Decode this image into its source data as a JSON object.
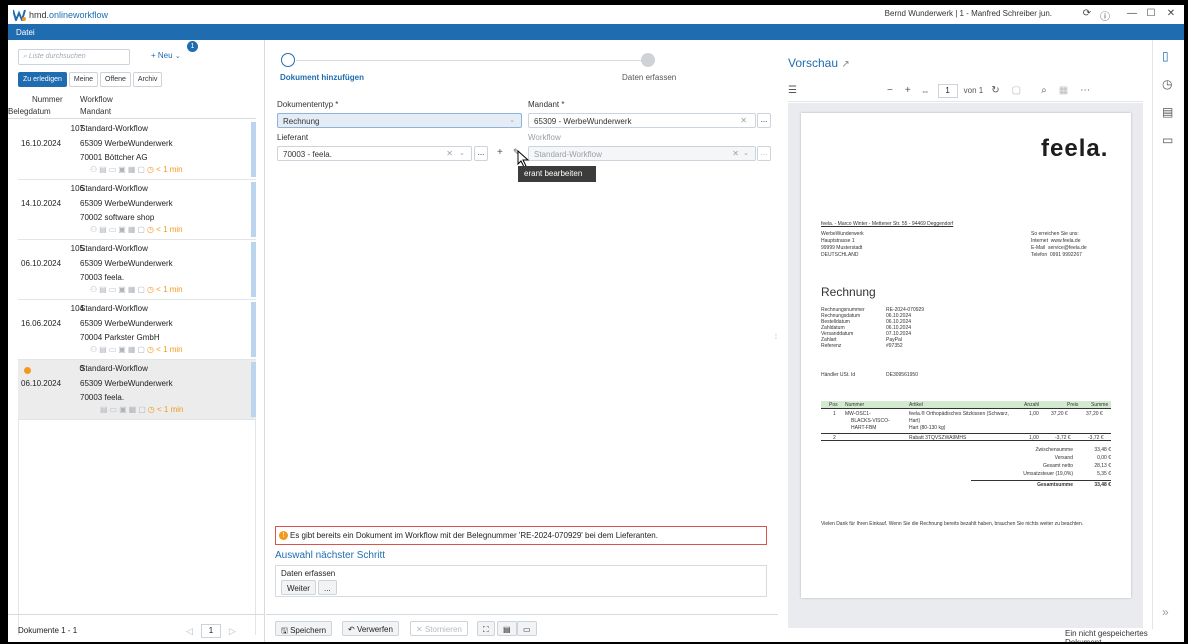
{
  "window": {
    "app_prefix": "hmd.",
    "app_name": "onlineworkflow",
    "user": "Bernd Wunderwerk | 1 - Manfred Schreiber jun."
  },
  "menu": {
    "datei": "Datei"
  },
  "left": {
    "search_placeholder": "Liste durchsuchen",
    "neu": "Neu",
    "badge": "1",
    "tabs": [
      "Zu erledigen",
      "Meine",
      "Offene",
      "Archiv"
    ],
    "col_nummer": "Nummer",
    "col_belegdatum": "Belegdatum",
    "col_workflow": "Workflow",
    "col_mandant": "Mandant",
    "rows": [
      {
        "num": "107",
        "date": "16.10.2024",
        "workflow": "Standard-Workflow",
        "mandant": "65309  WerbeWunderwerk",
        "partner": "70001  Böttcher AG",
        "time": "< 1 min"
      },
      {
        "num": "106",
        "date": "14.10.2024",
        "workflow": "Standard-Workflow",
        "mandant": "65309  WerbeWunderwerk",
        "partner": "70002  software shop",
        "time": "< 1 min"
      },
      {
        "num": "105",
        "date": "06.10.2024",
        "workflow": "Standard-Workflow",
        "mandant": "65309  WerbeWunderwerk",
        "partner": "70003  feela.",
        "time": "< 1 min"
      },
      {
        "num": "104",
        "date": "16.06.2024",
        "workflow": "Standard-Workflow",
        "mandant": "65309  WerbeWunderwerk",
        "partner": "70004  Parkster GmbH",
        "time": "< 1 min"
      },
      {
        "num": "0",
        "date": "06.10.2024",
        "workflow": "Standard-Workflow",
        "mandant": "65309  WerbeWunderwerk",
        "partner": "70003  feela.",
        "time": "< 1 min"
      }
    ],
    "count": "Dokumente 1 - 1",
    "page": "1"
  },
  "main": {
    "step1": "Dokument hinzufügen",
    "step2": "Daten erfassen",
    "doctyp_label": "Dokumententyp *",
    "doctyp_value": "Rechnung",
    "mandant_label": "Mandant *",
    "mandant_value": "65309 - WerbeWunderwerk",
    "lieferant_label": "Lieferant",
    "lieferant_value": "70003 - feela.",
    "workflow_label": "Workflow",
    "workflow_value": "Standard-Workflow",
    "tooltip": "erant bearbeiten",
    "warning": "Es gibt bereits ein Dokument im Workflow mit der Belegnummer 'RE-2024-070929' bei dem Lieferanten.",
    "next_step": "Auswahl nächster Schritt",
    "daten_erfassen": "Daten erfassen",
    "weiter": "Weiter",
    "dots": "...",
    "speichern": "Speichern",
    "verwerfen": "Verwerfen",
    "stornieren": "Stornieren"
  },
  "preview": {
    "title": "Vorschau",
    "page": "1",
    "of": "von 1",
    "doc": {
      "logo": "feela.",
      "sender": "feela. - Marco Winter - Mettener Str. 55 - 94469 Deggendorf",
      "addr": [
        "WerbeWunderwerk",
        "Hauptstrasse 1",
        "99999 Musterstadt",
        "DEUTSCHLAND"
      ],
      "contact_title": "So erreichen Sie uns:",
      "contact": [
        [
          "Internet",
          "www.feela.de"
        ],
        [
          "E-Mail",
          "service@feela.de"
        ],
        [
          "Telefon",
          "0991 9992267"
        ]
      ],
      "heading": "Rechnung",
      "meta": [
        [
          "Rechnungsnummer",
          "RE-2024-070929"
        ],
        [
          "Rechnungsdatum",
          "06.10.2024"
        ],
        [
          "Bestelldatum",
          "06.10.2024"
        ],
        [
          "Zahldatum",
          "06.10.2024"
        ],
        [
          "Versanddatum",
          "07.10.2024"
        ],
        [
          "Zahlart",
          "PayPal"
        ],
        [
          "Referenz",
          "#97352"
        ]
      ],
      "ust_label": "Händler USt. Id",
      "ust": "DE309561950",
      "th": [
        "Pos",
        "Nummer",
        "Artikel",
        "Anzahl",
        "Preis",
        "Summe"
      ],
      "r1": [
        "1",
        "MW-OSC1-",
        "feela.® Orthopädisches Sitzkissen (Schwarz,",
        "1,00",
        "37,20 €",
        "37,20 €"
      ],
      "r1b": [
        "BLACKS-VISCO-",
        "Hart)"
      ],
      "r1c": [
        "HART-FBM",
        "Hart (80-130 kg)"
      ],
      "r2": [
        "2",
        "Rabatt 3TQVSZWA9MHS",
        "1,00",
        "-3,72 €",
        "-3,72 €"
      ],
      "totals": [
        [
          "Zwischensumme",
          "33,48 €"
        ],
        [
          "Versand",
          "0,00 €"
        ],
        [
          "Gesamt netto",
          "28,13 €"
        ],
        [
          "Umsatzsteuer (19,0%)",
          "5,35 €"
        ]
      ],
      "total": [
        "Gesamtsumme",
        "33,48 €"
      ],
      "thanks": "Vielen Dank für Ihren Einkauf. Wenn Sie die Rechnung bereits bezahlt haben, brauchen Sie nichts weiter zu beachten."
    }
  },
  "status": "Ein nicht gespeichertes Dokument",
  "colors": {
    "accent": "#1f6db0",
    "warn": "#f39a1e",
    "error": "#d9534f"
  }
}
